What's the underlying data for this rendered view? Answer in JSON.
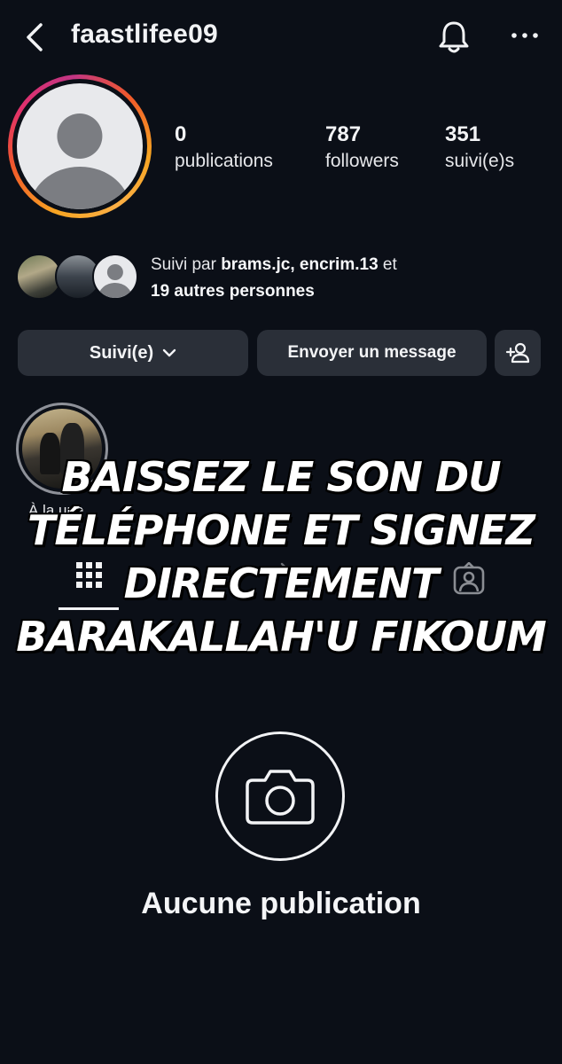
{
  "header": {
    "username": "faastlifee09",
    "back_icon": "chevron-left-icon",
    "notification_icon": "bell-icon",
    "more_icon": "more-horizontal-icon"
  },
  "profile": {
    "stats": [
      {
        "value": "0",
        "label": "publications"
      },
      {
        "value": "787",
        "label": "followers"
      },
      {
        "value": "351",
        "label": "suivi(e)s"
      }
    ],
    "story_ring_colors": [
      "#f7a523",
      "#e1306c",
      "#c13584"
    ]
  },
  "followed_by": {
    "prefix": "Suivi par",
    "names": "brams.jc, encrim.13",
    "conjunction": "et",
    "others": "19 autres personnes"
  },
  "actions": {
    "follow_label": "Suivi(e)",
    "message_label": "Envoyer un message",
    "add_user_icon": "add-person-icon"
  },
  "highlight": {
    "label": "À la une"
  },
  "tabs": {
    "grid_icon": "grid-icon",
    "reels_icon": "reels-icon",
    "tagged_icon": "tagged-icon"
  },
  "overlay_caption": {
    "lines": [
      "Baissez le son du",
      "téléphone et signez",
      "directement",
      "Barakallah'u fikoum"
    ]
  },
  "empty_state": {
    "icon": "camera-icon",
    "text": "Aucune publication"
  },
  "colors": {
    "background": "#0b0f17",
    "button_bg": "#2a2f38",
    "text": "#f2f3f5"
  }
}
